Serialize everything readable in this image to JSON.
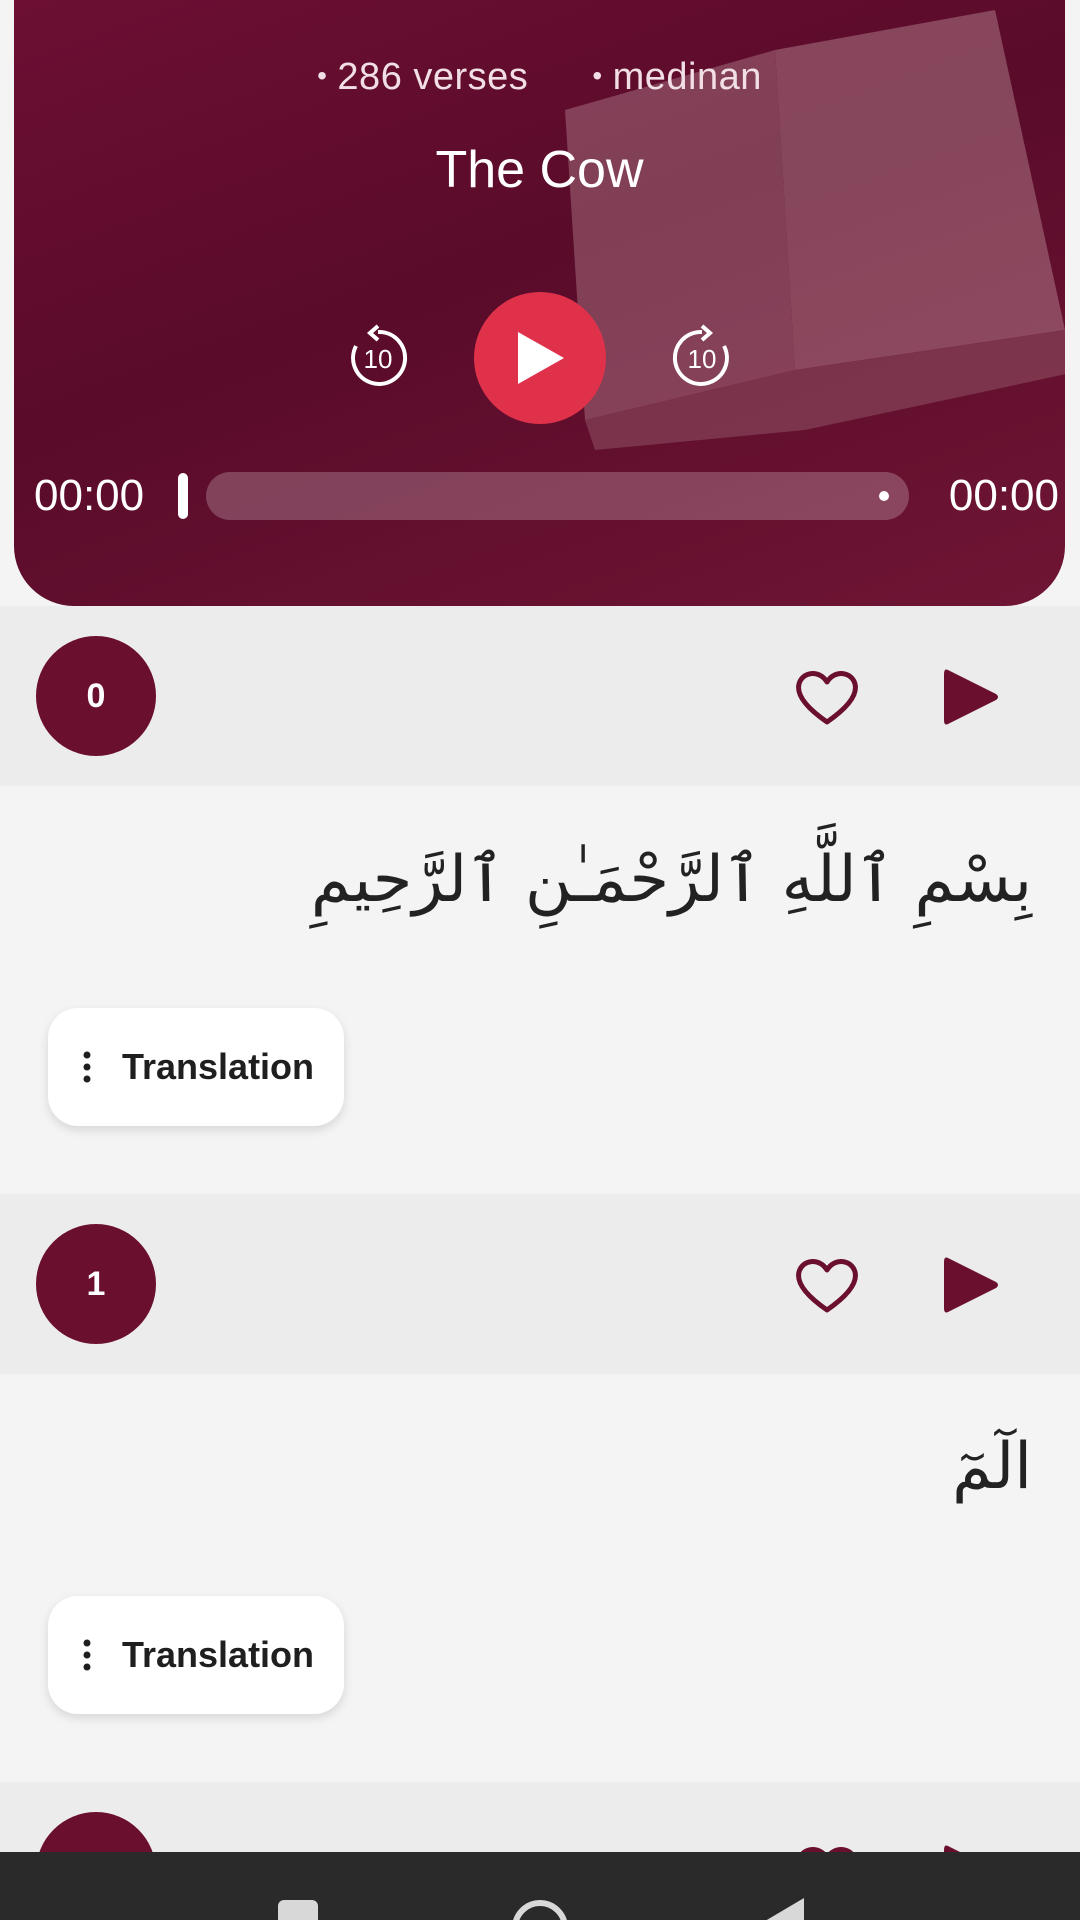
{
  "player": {
    "verses": "286 verses",
    "type": "medinan",
    "title": "The Cow",
    "rewind_seconds": "10",
    "forward_seconds": "10",
    "current_time": "00:00",
    "total_time": "00:00"
  },
  "verses": [
    {
      "number": "0",
      "arabic": "بِسْمِ ٱللَّهِ ٱلرَّحْمَـٰنِ ٱلرَّحِيمِ",
      "translation_label": "Translation"
    },
    {
      "number": "1",
      "arabic": "الٓمٓ",
      "translation_label": "Translation"
    }
  ],
  "colors": {
    "maroon": "#6a0f2e",
    "play_red": "#e0314b",
    "heart": "#6a0f2e"
  },
  "icons": {
    "rewind": "replay-10-icon",
    "forward": "forward-10-icon",
    "play": "play-icon",
    "favorite": "heart-outline-icon",
    "menu": "kebab-menu-icon"
  }
}
